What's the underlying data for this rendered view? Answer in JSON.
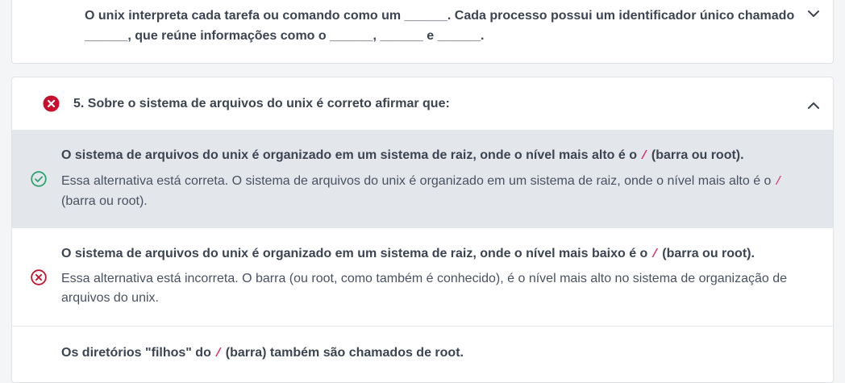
{
  "previous_question": {
    "text_line1": "O unix interpreta cada tarefa ou comando como um ______. Cada processo possui um identificador único chamado",
    "text_line2": "______, que reúne informações como o ______, ______ e ______."
  },
  "question": {
    "title": "5. Sobre o sistema de arquivos do unix é correto afirmar que:",
    "status": "incorrect",
    "alternatives": [
      {
        "state": "correct",
        "title_before": "O sistema de arquivos do unix é organizado em um sistema de raiz, onde o nível mais alto é o",
        "code": "/",
        "title_after": "(barra ou root).",
        "feedback_line1_before": "Essa alternativa está correta. O sistema de arquivos do unix é organizado em um sistema de raiz, onde o nível mais alto é o",
        "feedback_code": "/",
        "feedback_line2": "(barra ou root)."
      },
      {
        "state": "incorrect",
        "title_before": "O sistema de arquivos do unix é organizado em um sistema de raiz, onde o nível mais baixo é o",
        "code": "/",
        "title_after": "(barra ou root).",
        "feedback_line1": "Essa alternativa está incorreta. O barra (ou root, como também é conhecido), é o nível mais alto no sistema de organização de",
        "feedback_line2": "arquivos do unix."
      },
      {
        "state": "neutral",
        "title_before": "Os diretórios \"filhos\" do",
        "code": "/",
        "title_after": "(barra) também são chamados de root."
      }
    ]
  },
  "colors": {
    "error_red": "#c8102e",
    "success_green": "#2fa36b",
    "code_pink": "#d6336c"
  },
  "icons": {
    "collapse": "chevron-up-icon",
    "expand": "chevron-down-icon",
    "question_status": "x-circle-filled-icon",
    "alt_correct": "check-circle-outline-icon",
    "alt_incorrect": "x-circle-outline-icon"
  }
}
